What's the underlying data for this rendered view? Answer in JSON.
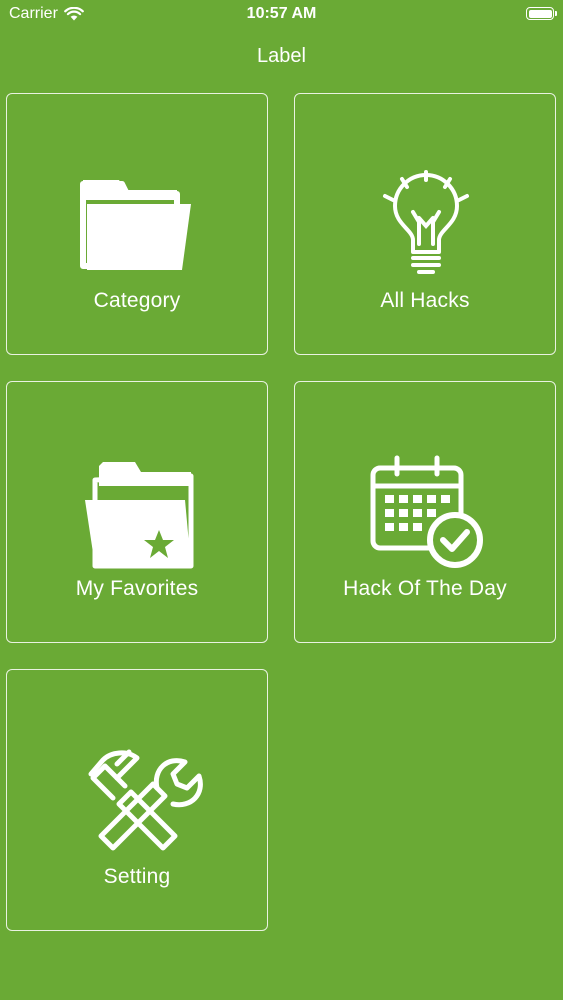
{
  "status_bar": {
    "carrier": "Carrier",
    "time": "10:57 AM"
  },
  "nav": {
    "title": "Label"
  },
  "menu": {
    "items": [
      {
        "label": "Category",
        "icon": "folder-icon"
      },
      {
        "label": "All Hacks",
        "icon": "lightbulb-icon"
      },
      {
        "label": "My Favorites",
        "icon": "folder-star-icon"
      },
      {
        "label": "Hack Of The Day",
        "icon": "calendar-check-icon"
      },
      {
        "label": "Setting",
        "icon": "tools-icon"
      }
    ]
  },
  "colors": {
    "background": "#6aaa35",
    "foreground": "#ffffff"
  }
}
